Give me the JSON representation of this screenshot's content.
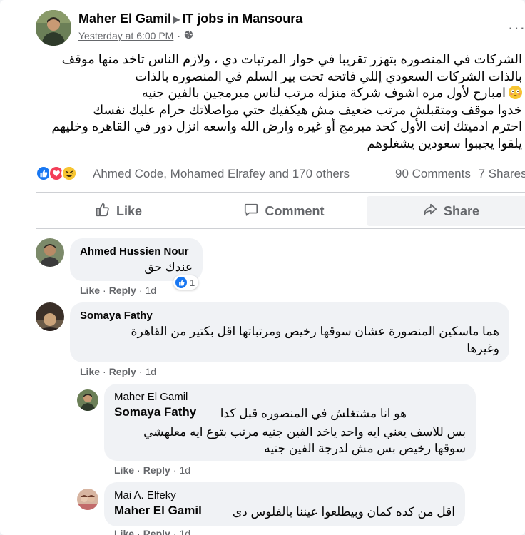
{
  "post": {
    "author": "Maher El Gamil",
    "group": "IT jobs in Mansoura",
    "time": "Yesterday at 6:00 PM",
    "privacy_icon": "globe-icon",
    "more_icon": "ellipsis-icon",
    "body_lines": [
      "الشركات في المنصوره بتهزر تقريبا في حوار المرتبات دي ، ولازم الناس تاخد منها موقف",
      "بالذات الشركات السعودي إللي فاتحه تحت بير السلم في المنصوره بالذات",
      "امبارح لأول مره اشوف شركة منزله مرتب لناس مبرمجين بالفين جنيه",
      "خدوا موقف ومتقبلش مرتب ضعيف مش هيكفيك حتي مواصلاتك حرام عليك نفسك",
      "احترم ادميتك إنت الأول كحد مبرمج أو غيره وارض الله واسعه انزل دور في القاهره وخليهم",
      "يلقوا يجيبوا سعودين يشغلوهم"
    ],
    "emoji_line_index": 2,
    "reactions_summary": "Ahmed Code, Mohamed Elrafey and 170 others",
    "comments_count": "90 Comments",
    "shares_count": "7 Shares",
    "actions": {
      "like": "Like",
      "comment": "Comment",
      "share": "Share"
    }
  },
  "comments": [
    {
      "name": "Ahmed Hussien Nour",
      "text": "عندك حق",
      "like": "Like",
      "reply": "Reply",
      "age": "1d",
      "reaction_count": "1"
    },
    {
      "name": "Somaya Fathy",
      "text_lines": [
        "هما ماسكين المنصورة عشان سوقها رخيص ومرتباتها اقل بكتير من القاهرة",
        "وغيرها"
      ],
      "like": "Like",
      "reply": "Reply",
      "age": "1d"
    }
  ],
  "replies": [
    {
      "name": "Maher El Gamil",
      "mention": "Somaya Fathy",
      "first_text": "هو انا مشتغلش في المنصوره قبل كدا",
      "text_lines": [
        "بس للاسف يعني ايه واحد ياخد الفين جنيه مرتب بتوع ايه معلهشي",
        "سوقها رخيص بس مش لدرجة الفين جنيه"
      ],
      "like": "Like",
      "reply": "Reply",
      "age": "1d"
    },
    {
      "name": "Mai A. Elfeky",
      "mention": "Maher El Gamil",
      "first_text": "اقل من كده كمان وبيطلعوا عيننا بالفلوس دى",
      "like": "Like",
      "reply": "Reply",
      "age": "1d"
    }
  ],
  "colors": {
    "text": "#050505",
    "secondary": "#65676b",
    "bubble": "#f0f2f5",
    "like_blue": "#1877f2",
    "love_red": "#f33e58",
    "haha_yellow": "#f7c532"
  }
}
